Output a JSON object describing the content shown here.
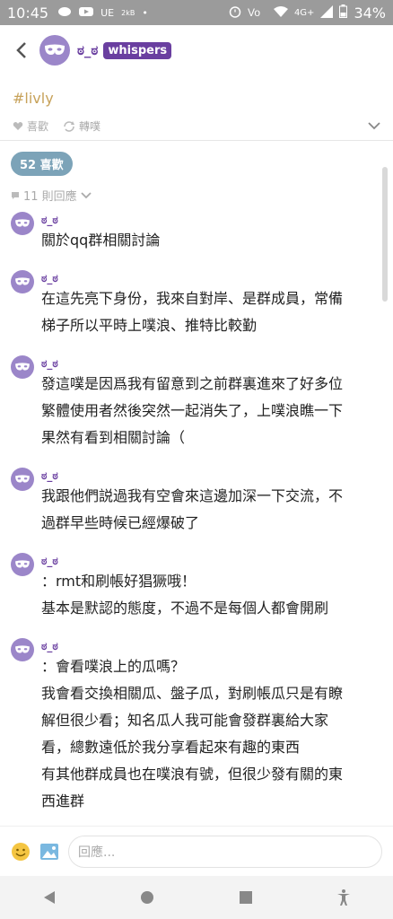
{
  "status_bar": {
    "time": "10:45",
    "carrier": "UE",
    "speed": "2kB",
    "network": "4G+",
    "battery": "34%"
  },
  "header": {
    "username": "ಠ_ಠ",
    "badge": "whispers"
  },
  "post": {
    "hashtag": "#livly",
    "like_label": "喜歡",
    "replurk_label": "轉噗"
  },
  "likes": {
    "label": "52 喜歡"
  },
  "replies": {
    "label": "11 則回應"
  },
  "comments": [
    {
      "user": "ಠ_ಠ",
      "lines": [
        "關於qq群相關討論"
      ]
    },
    {
      "user": "ಠ_ಠ",
      "lines": [
        "在這先亮下身份，我來自對岸、是群成員，常備",
        "梯子所以平時上噗浪、推特比較勤"
      ]
    },
    {
      "user": "ಠ_ಠ",
      "lines": [
        "發這噗是因爲我有留意到之前群裏進來了好多位",
        "繁體使用者然後突然一起消失了，上噗浪瞧一下",
        "果然有看到相關討論（"
      ]
    },
    {
      "user": "ಠ_ಠ",
      "lines": [
        "我跟他們説過我有空會來這邊加深一下交流，不",
        "過群早些時候已經爆破了"
      ]
    },
    {
      "user": "ಠ_ಠ",
      "lines": [
        "：rmt和刷帳好猖獗哦！",
        "基本是默認的態度，不過不是每個人都會開刷"
      ]
    },
    {
      "user": "ಠ_ಠ",
      "lines": [
        "：會看噗浪上的瓜嗎？",
        "我會看交換相關瓜、盤子瓜，對刷帳瓜只是有瞭",
        "解但很少看；知名瓜人我可能會發群裏給大家",
        "看，總數遠低於我分享看起來有趣的東西",
        "有其他群成員也在噗浪有號，但很少發有關的東",
        "西進群"
      ]
    }
  ],
  "composer": {
    "placeholder": "回應..."
  },
  "colors": {
    "accent": "#6a3fa0",
    "hashtag": "#c7a25a",
    "likes_pill": "#7ca3b8",
    "avatar": "#9b86c9"
  }
}
